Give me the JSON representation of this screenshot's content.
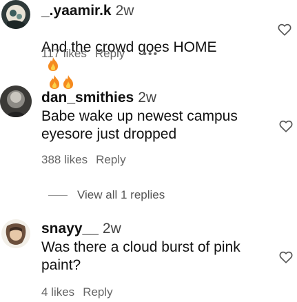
{
  "comments": [
    {
      "username": "_.yaamir.k",
      "time": "2w",
      "text": "And the crowd goes HOME",
      "likes": "117 likes",
      "reply": "Reply",
      "more": "•••"
    },
    {
      "username": "dan_smithies",
      "time": "2w",
      "text": "Babe wake up newest campus\neyesore just dropped",
      "likes": "388 likes",
      "reply": "Reply"
    },
    {
      "username": "snayy__",
      "time": "2w",
      "text": "Was there a cloud burst of pink\npaint?",
      "likes": "4 likes",
      "reply": "Reply"
    }
  ],
  "view_replies": "View all 1 replies",
  "icons": {
    "heart": "heart-outline-icon",
    "fire": "fire-emoji-icon"
  },
  "colors": {
    "fire_outer": "#f58a1f",
    "fire_inner": "#fbd24a"
  }
}
